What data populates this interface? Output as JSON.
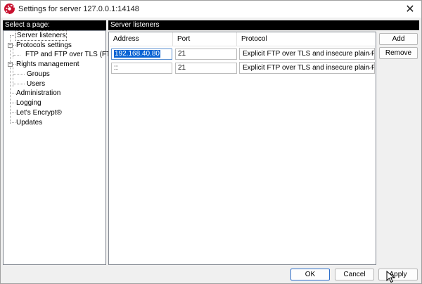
{
  "window": {
    "title": "Settings for server 127.0.0.1:14148",
    "close_glyph": "✕"
  },
  "left": {
    "header": "Select a page:",
    "tree": [
      {
        "label": "Server listeners",
        "selected": true
      },
      {
        "label": "Protocols settings",
        "expander": "−"
      },
      {
        "label": "FTP and FTP over TLS (FTPS)"
      },
      {
        "label": "Rights management",
        "expander": "−"
      },
      {
        "label": "Groups"
      },
      {
        "label": "Users"
      },
      {
        "label": "Administration"
      },
      {
        "label": "Logging"
      },
      {
        "label": "Let's Encrypt®"
      },
      {
        "label": "Updates"
      }
    ]
  },
  "right": {
    "header": "Server listeners",
    "columns": [
      "Address",
      "Port",
      "Protocol"
    ],
    "rows": [
      {
        "address": "192.168.40.80",
        "port": "21",
        "protocol": "Explicit FTP over TLS and insecure plain FTP"
      },
      {
        "address": "::",
        "port": "21",
        "protocol": "Explicit FTP over TLS and insecure plain FTP"
      }
    ],
    "dropdown_glyph": "⌵"
  },
  "buttons": {
    "add": "Add",
    "remove": "Remove",
    "ok": "OK",
    "cancel": "Cancel",
    "apply": "Apply"
  },
  "icons": {
    "app": "filezilla-server-icon",
    "cursor": "mouse-pointer-icon"
  },
  "colors": {
    "header_bg": "#000000",
    "selection": "#0a64d4",
    "focus_border": "#2f6fca"
  }
}
